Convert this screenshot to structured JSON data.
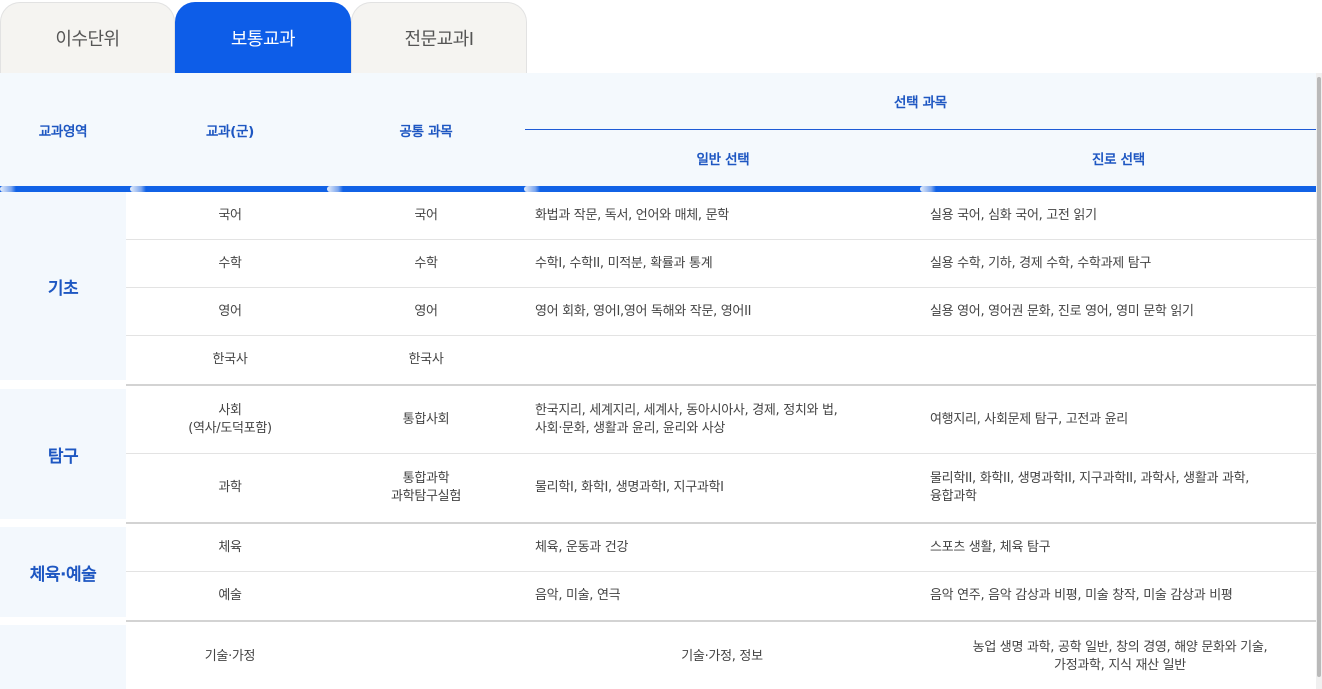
{
  "tabs": [
    {
      "label": "이수단위",
      "active": false
    },
    {
      "label": "보통교과",
      "active": true
    },
    {
      "label": "전문교과I",
      "active": false
    }
  ],
  "colors": {
    "accent": "#0d5de8",
    "header_text": "#1e57c2",
    "header_bg": "#f4f9fd"
  },
  "table": {
    "headers": {
      "area": "교과영역",
      "subject": "교과(군)",
      "common": "공통 과목",
      "elective": "선택 과목",
      "general": "일반 선택",
      "career": "진로 선택"
    },
    "groups": [
      {
        "area": "기초",
        "rows": [
          {
            "subject": "국어",
            "common": "국어",
            "general": "화법과 작문, 독서, 언어와 매체, 문학",
            "career": "실용 국어, 심화 국어, 고전 읽기"
          },
          {
            "subject": "수학",
            "common": "수학",
            "general": "수학I, 수학II, 미적분, 확률과 통계",
            "career": "실용 수학, 기하, 경제 수학, 수학과제 탐구"
          },
          {
            "subject": "영어",
            "common": "영어",
            "general": "영어 회화, 영어I,영어 독해와 작문, 영어II",
            "career": "실용 영어, 영어권 문화, 진로 영어, 영미 문학 읽기"
          },
          {
            "subject": "한국사",
            "common": "한국사",
            "general": "",
            "career": ""
          }
        ]
      },
      {
        "area": "탐구",
        "rows": [
          {
            "subject": "사회\n(역사/도덕포함)",
            "common": "통합사회",
            "general": "한국지리, 세계지리, 세계사, 동아시아사, 경제, 정치와 법,\n사회·문화, 생활과 윤리, 윤리와 사상",
            "career": "여행지리, 사회문제 탐구, 고전과 윤리"
          },
          {
            "subject": "과학",
            "common": "통합과학\n과학탐구실험",
            "general": "물리학I, 화학I, 생명과학I, 지구과학I",
            "career": "물리학II, 화학II, 생명과학II, 지구과학II, 과학사, 생활과 과학,\n융합과학"
          }
        ]
      },
      {
        "area": "체육·예술",
        "rows": [
          {
            "subject": "체육",
            "common": "",
            "general": "체육, 운동과 건강",
            "career": "스포츠 생활, 체육 탐구"
          },
          {
            "subject": "예술",
            "common": "",
            "general": "음악, 미술, 연극",
            "career": "음악 연주, 음악 감상과 비평, 미술 창작, 미술 감상과 비평"
          }
        ]
      },
      {
        "area": "",
        "rows": [
          {
            "subject": "기술·가정",
            "common_general": "기술·가정, 정보",
            "career": "농업 생명 과학, 공학 일반, 창의 경영, 해양 문화와 기술,\n가정과학, 지식 재산 일반"
          }
        ]
      }
    ]
  }
}
